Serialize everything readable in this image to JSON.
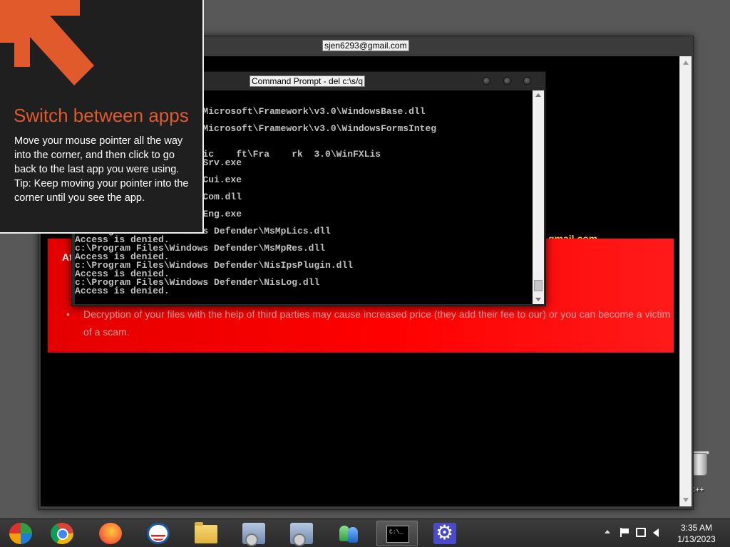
{
  "desktop": {
    "recycle_bin_caption": "n C++"
  },
  "browser": {
    "title": "sjen6293@gmail.com",
    "email_highlight": "gmail.com",
    "banner_prefix": "At",
    "bullets": [
      "Decryption of your files with the help of third parties may cause increased price (they add their fee to our) or you can become a victim of a scam."
    ]
  },
  "cmd": {
    "title": "Command Prompt - del  c:\\s/q",
    "lines": [
      "",
      "",
      "       ence Assemblies\\Microsoft\\Framework\\v3.0\\WindowsBase.dll",
      "",
      "       ence Assemblies\\Microsoft\\Framework\\v3.0\\WindowsFormsInteg",
      "",
      "",
      "           As  mbli  \\Mic    ft\\Fra    rk  3.0\\WinFXLis    ",
      "       ws Defender\\MpUXSrv.exe",
      "",
      "       ws Defender\\MSASCui.exe",
      "",
      "       ws Defender\\MsMpCom.dll",
      "",
      "       ws Defender\\MsMpEng.exe",
      "",
      "c:\\Program Files\\Windows Defender\\MsMpLics.dll",
      "Access is denied.",
      "c:\\Program Files\\Windows Defender\\MsMpRes.dll",
      "Access is denied.",
      "c:\\Program Files\\Windows Defender\\NisIpsPlugin.dll",
      "Access is denied.",
      "c:\\Program Files\\Windows Defender\\NisLog.dll",
      "Access is denied."
    ]
  },
  "tip": {
    "heading": "Switch between apps",
    "body_line1": "Move your mouse pointer all the way into the corner, and then click to go back to the last app you were using.",
    "body_line2": "Tip: Keep moving your pointer into the corner until you see the app.",
    "accent_color": "#e05a2b"
  },
  "taskbar": {
    "apps": [
      {
        "icon": "media-center-icon"
      },
      {
        "icon": "chrome-icon"
      },
      {
        "icon": "firefox-icon"
      },
      {
        "icon": "obama-logo-icon"
      },
      {
        "icon": "file-explorer-icon"
      },
      {
        "icon": "installer-icon"
      },
      {
        "icon": "installer-icon"
      },
      {
        "icon": "people-icon"
      },
      {
        "icon": "command-prompt-icon"
      },
      {
        "icon": "settings-gear-icon"
      }
    ],
    "clock_time": "3:35 AM",
    "clock_date": "1/13/2023"
  }
}
